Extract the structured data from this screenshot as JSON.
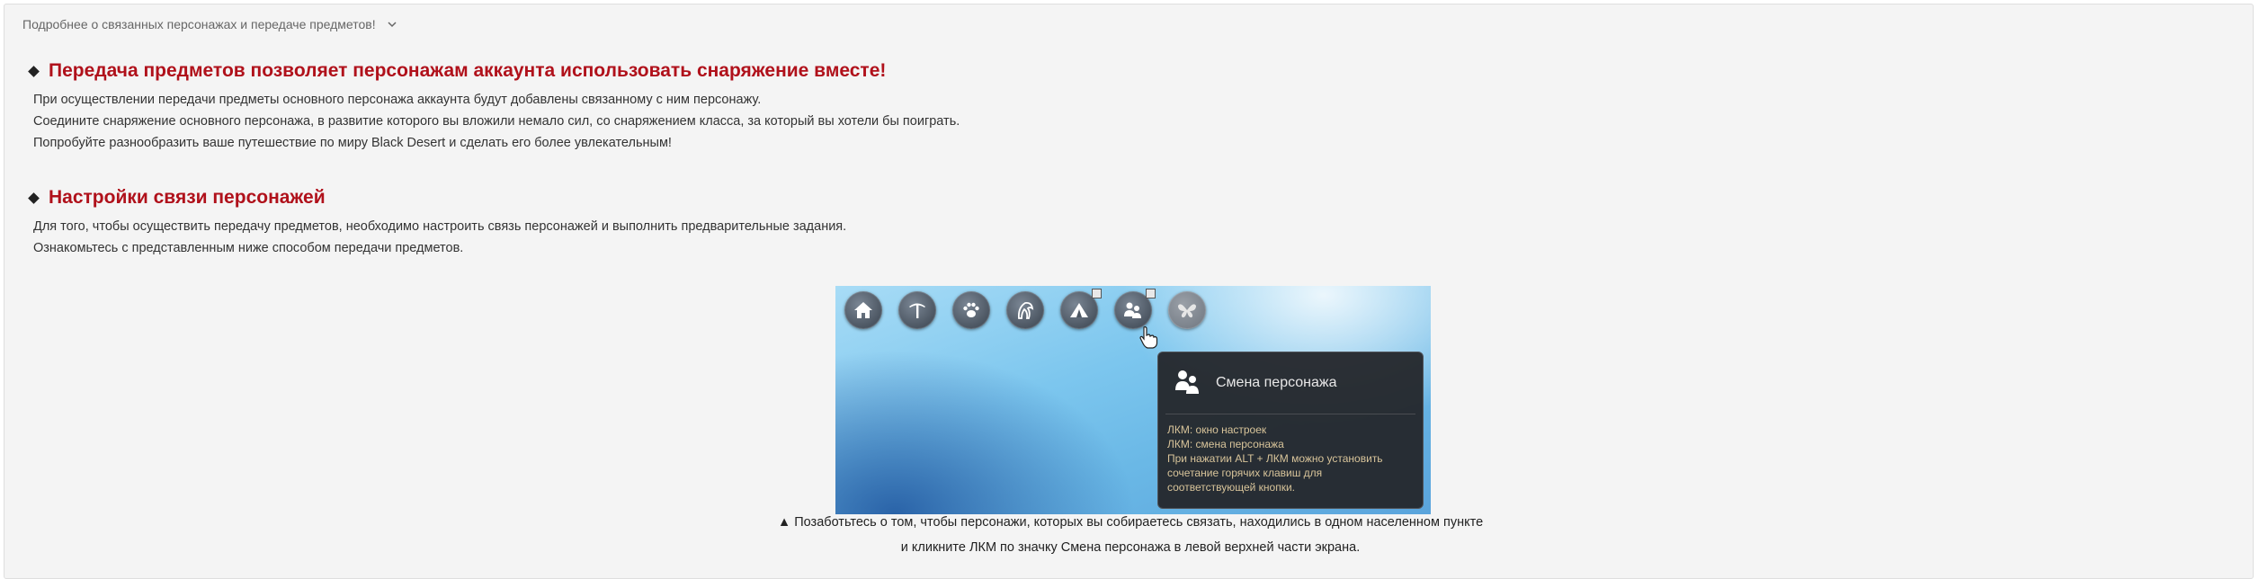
{
  "toggle_label": "Подробнее о связанных персонажах и передаче предметов!",
  "section1": {
    "title": "Передача предметов позволяет персонажам аккаунта использовать снаряжение вместе!",
    "lines": [
      "При осуществлении передачи предметы основного персонажа аккаунта будут добавлены связанному с ним персонажу.",
      "Соедините снаряжение основного персонажа, в развитие которого вы вложили немало сил, со снаряжением класса, за который вы хотели бы поиграть.",
      "Попробуйте разнообразить ваше путешествие по миру Black Desert и сделать его более увлекательным!"
    ]
  },
  "section2": {
    "title": "Настройки связи персонажей",
    "lines": [
      "Для того, чтобы осуществить передачу предметов, необходимо настроить связь персонажей и выполнить предварительные задания.",
      "Ознакомьтесь с представленным ниже способом передачи предметов."
    ]
  },
  "game_screenshot": {
    "icons": [
      "house-icon",
      "pickaxe-icon",
      "paw-icon",
      "horse-icon",
      "camp-icon",
      "character-swap-icon",
      "butterfly-icon"
    ],
    "tooltip": {
      "title": "Смена персонажа",
      "lines": [
        "ЛКМ: окно настроек",
        "ЛКМ: смена персонажа",
        "При нажатии ALT + ЛКМ можно установить",
        "сочетание горячих клавиш для",
        "соответствующей кнопки."
      ]
    }
  },
  "caption": {
    "line1": "▲ Позаботьтесь о том, чтобы персонажи, которых вы собираетесь связать, находились в одном населенном пункте",
    "line2": "и кликните ЛКМ по значку Смена персонажа в левой верхней части экрана."
  },
  "colors": {
    "accent_red": "#b0111b",
    "panel_bg": "#f4f4f4",
    "tooltip_text": "#d8c49a"
  }
}
